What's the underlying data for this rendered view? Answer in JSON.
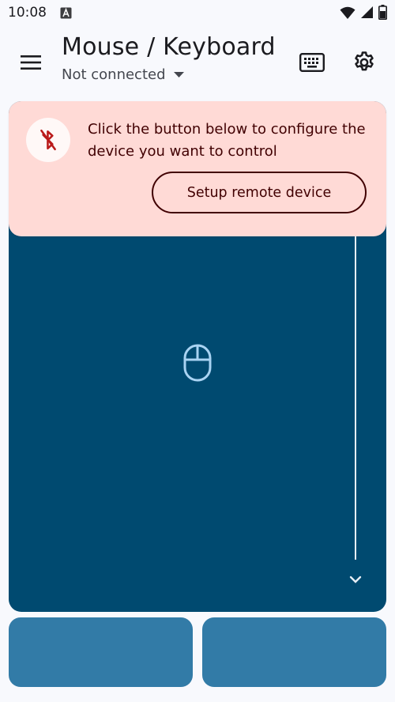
{
  "status_bar": {
    "time": "10:08",
    "icons": [
      "a-notification-icon",
      "wifi-icon",
      "cell-signal-icon",
      "battery-icon"
    ]
  },
  "app_bar": {
    "title": "Mouse / Keyboard",
    "connection_status": "Not connected",
    "icons": [
      "menu-icon",
      "dropdown-arrow-icon",
      "keyboard-icon",
      "gear-icon"
    ]
  },
  "banner": {
    "message": "Click the button below to configure the device you want to control",
    "button_label": "Setup remote device",
    "icon": "bluetooth-disabled-icon"
  },
  "touchpad": {
    "icons": [
      "mouse-icon",
      "chevron-down-icon"
    ]
  },
  "colors": {
    "background": "#f8f9fd",
    "touchpad": "#004a70",
    "banner": "#ffdad6",
    "banner_text": "#410002",
    "mouse_buttons": "#327ba7"
  }
}
